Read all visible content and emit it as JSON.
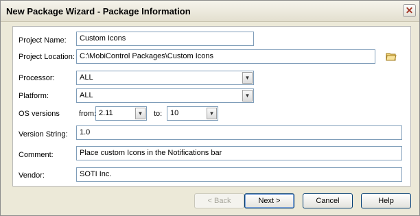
{
  "window": {
    "title": "New Package Wizard - Package Information"
  },
  "form": {
    "project_name": {
      "label": "Project Name:",
      "value": "Custom Icons"
    },
    "project_location": {
      "label": "Project Location:",
      "value": "C:\\MobiControl Packages\\Custom Icons"
    },
    "processor": {
      "label": "Processor:",
      "value": "ALL"
    },
    "platform": {
      "label": "Platform:",
      "value": "ALL"
    },
    "os_versions": {
      "label": "OS versions",
      "from_label": "from:",
      "from_value": "2.11",
      "to_label": "to:",
      "to_value": "10"
    },
    "version_string": {
      "label": "Version String:",
      "value": "1.0"
    },
    "comment": {
      "label": "Comment:",
      "value": "Place custom Icons in the Notifications bar"
    },
    "vendor": {
      "label": "Vendor:",
      "value": "SOTI Inc."
    }
  },
  "buttons": {
    "back": "< Back",
    "next": "Next >",
    "cancel": "Cancel",
    "help": "Help"
  },
  "icons": {
    "close": "close-icon",
    "browse": "folder-icon",
    "dropdown": "chevron-down-icon"
  }
}
